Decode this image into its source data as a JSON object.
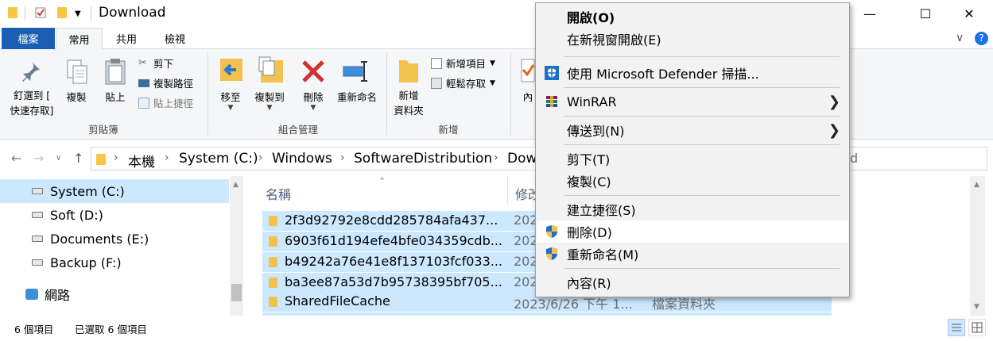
{
  "window": {
    "title": "Download",
    "minimize": "—",
    "maximize": "☐",
    "close": "✕",
    "help": "?",
    "ribbon_toggle": "∨"
  },
  "ribbon": {
    "tabs": [
      "檔案",
      "常用",
      "共用",
      "檢視"
    ],
    "clipboard": {
      "pin_label_1": "釘選到 [",
      "pin_label_2": "快速存取]",
      "copy": "複製",
      "paste": "貼上",
      "cut": "剪下",
      "copy_path": "複製路徑",
      "paste_shortcut": "貼上捷徑",
      "group": "剪貼簿"
    },
    "organize": {
      "move_1": "移至",
      "copy_1": "複製到",
      "delete": "刪除",
      "rename": "重新命名",
      "group": "組合管理"
    },
    "new": {
      "new_folder_1": "新增",
      "new_folder_2": "資料夾",
      "new_item": "新增項目",
      "easy_access": "輕鬆存取",
      "group": "新增"
    },
    "open": {
      "properties_partial": "內"
    }
  },
  "address": {
    "crumbs": [
      "本機",
      "System (C:)",
      "Windows",
      "SoftwareDistribution",
      "Dow"
    ],
    "search_partial": "d"
  },
  "nav": {
    "items": [
      {
        "label": "System (C:)",
        "selected": true
      },
      {
        "label": "Soft (D:)",
        "selected": false
      },
      {
        "label": "Documents (E:)",
        "selected": false
      },
      {
        "label": "Backup (F:)",
        "selected": false
      },
      {
        "label": "網路",
        "selected": false
      }
    ]
  },
  "files": {
    "col_name": "名稱",
    "col_date_partial": "修改",
    "rows": [
      {
        "name": "2f3d92792e8cdd285784afa437...",
        "date": "202",
        "type": ""
      },
      {
        "name": "6903f61d194efe4bfe034359cdb...",
        "date": "202",
        "type": ""
      },
      {
        "name": "b49242a76e41e8f137103fcf033...",
        "date": "202",
        "type": ""
      },
      {
        "name": "ba3ee87a53d7b95738395bf705...",
        "date": "202",
        "type": ""
      },
      {
        "name": "SharedFileCache",
        "date": "2023/6/26 下午 1...",
        "type": "檔案資料夾"
      }
    ]
  },
  "status": {
    "count": "6 個項目",
    "selected": "已選取 6 個項目"
  },
  "context_menu": {
    "open": "開啟(O)",
    "open_new_window": "在新視窗開啟(E)",
    "defender": "使用 Microsoft Defender 掃描...",
    "winrar": "WinRAR",
    "send_to": "傳送到(N)",
    "cut": "剪下(T)",
    "copy": "複製(C)",
    "create_shortcut": "建立捷徑(S)",
    "delete": "刪除(D)",
    "rename": "重新命名(M)",
    "properties": "內容(R)"
  },
  "colors": {
    "accent": "#1a5fb4",
    "selection": "#cce8ff",
    "folder": "#f2c14e",
    "delete_red": "#d32f2f"
  }
}
